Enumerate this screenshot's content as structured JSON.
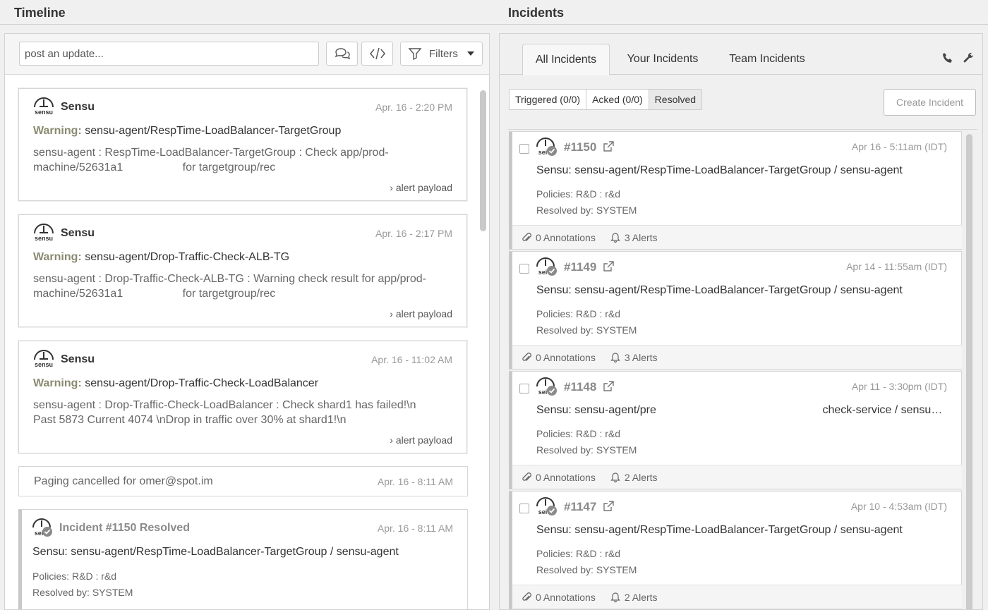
{
  "header": {
    "timeline_title": "Timeline",
    "incidents_title": "Incidents"
  },
  "timeline": {
    "post_placeholder": "post an update...",
    "filters_label": "Filters",
    "entries": [
      {
        "author": "Sensu",
        "time": "Apr. 16 - 2:20 PM",
        "warning_label": "Warning:",
        "check": "sensu-agent/RespTime-LoadBalancer-TargetGroup",
        "body_line1": "sensu-agent : RespTime-LoadBalancer-TargetGroup : Check app/prod-",
        "body_line2": "machine/52631a1                   for targetgroup/rec",
        "payload_link": "alert payload"
      },
      {
        "author": "Sensu",
        "time": "Apr. 16 - 2:17 PM",
        "warning_label": "Warning:",
        "check": "sensu-agent/Drop-Traffic-Check-ALB-TG",
        "body_line1": "sensu-agent : Drop-Traffic-Check-ALB-TG : Warning check result for app/prod-",
        "body_line2": "machine/52631a1                   for targetgroup/rec",
        "payload_link": "alert payload"
      },
      {
        "author": "Sensu",
        "time": "Apr. 16 - 11:02 AM",
        "warning_label": "Warning:",
        "check": "sensu-agent/Drop-Traffic-Check-LoadBalancer",
        "body_line1": "sensu-agent : Drop-Traffic-Check-LoadBalancer : Check shard1 has failed!\\n",
        "body_line2": "Past 5873 Current 4074 \\nDrop in traffic over 30% at shard1!\\n",
        "payload_link": "alert payload"
      }
    ],
    "paging": {
      "text": "Paging cancelled for omer@spot.im",
      "time": "Apr. 16 - 8:11 AM"
    },
    "resolved": {
      "title": "Incident #1150 Resolved",
      "time": "Apr. 16 - 8:11 AM",
      "summary": "Sensu: sensu-agent/RespTime-LoadBalancer-TargetGroup / sensu-agent",
      "policies": "Policies: R&D : r&d",
      "resolved_by": "Resolved by: SYSTEM"
    }
  },
  "incidents": {
    "tabs": [
      "All Incidents",
      "Your Incidents",
      "Team Incidents"
    ],
    "filters": [
      "Triggered (0/0)",
      "Acked (0/0)",
      "Resolved"
    ],
    "create_label": "Create Incident",
    "items": [
      {
        "number": "#1150",
        "time": "Apr 16 - 5:11am (IDT)",
        "summary": "Sensu: sensu-agent/RespTime-LoadBalancer-TargetGroup / sensu-agent",
        "policies": "Policies: R&D : r&d",
        "resolved_by": "Resolved by: SYSTEM",
        "annotations": "0 Annotations",
        "alerts": "3 Alerts"
      },
      {
        "number": "#1149",
        "time": "Apr 14 - 11:55am (IDT)",
        "summary": "Sensu: sensu-agent/RespTime-LoadBalancer-TargetGroup / sensu-agent",
        "policies": "Policies: R&D : r&d",
        "resolved_by": "Resolved by: SYSTEM",
        "annotations": "0 Annotations",
        "alerts": "3 Alerts"
      },
      {
        "number": "#1148",
        "time": "Apr 11 - 3:30pm (IDT)",
        "summary": "Sensu: sensu-agent/pre                                                     check-service / sensu…",
        "policies": "Policies: R&D : r&d",
        "resolved_by": "Resolved by: SYSTEM",
        "annotations": "0 Annotations",
        "alerts": "2 Alerts"
      },
      {
        "number": "#1147",
        "time": "Apr 10 - 4:53am (IDT)",
        "summary": "Sensu: sensu-agent/RespTime-LoadBalancer-TargetGroup / sensu-agent",
        "policies": "Policies: R&D : r&d",
        "resolved_by": "Resolved by: SYSTEM",
        "annotations": "0 Annotations",
        "alerts": "2 Alerts"
      }
    ]
  },
  "icons": [
    "sensu-logo-icon",
    "comments-icon",
    "code-icon",
    "filter-icon",
    "caret-down-icon",
    "phone-icon",
    "wrench-icon",
    "external-link-icon",
    "paperclip-icon",
    "bell-icon",
    "check-badge-icon"
  ],
  "colors": {
    "warning_label": "#8a8a70",
    "muted_text": "#999999",
    "resolved_border": "#c8c8c8"
  }
}
